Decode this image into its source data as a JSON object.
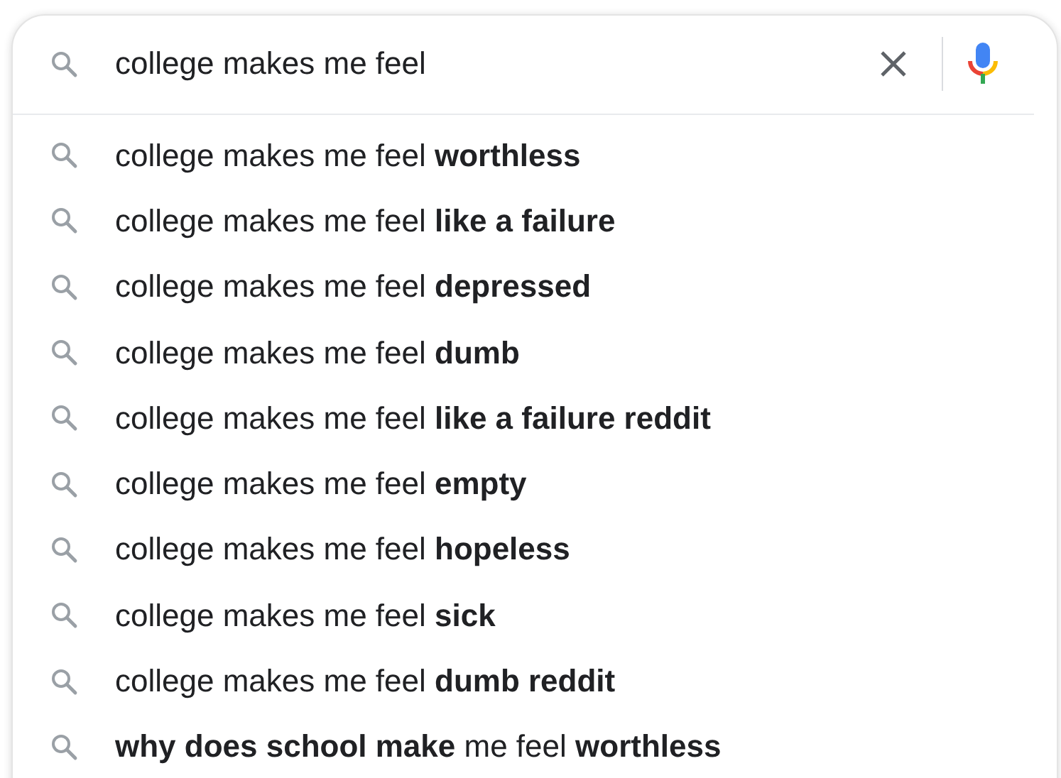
{
  "search": {
    "value": "college makes me feel"
  },
  "suggestions": [
    "college makes me feel **worthless**",
    "college makes me feel **like a failure**",
    "college makes me feel **depressed**",
    "college makes me feel **dumb**",
    "college makes me feel **like a failure reddit**",
    "college makes me feel **empty**",
    "college makes me feel **hopeless**",
    "college makes me feel **sick**",
    "college makes me feel **dumb reddit**",
    "**why does school make** me feel **worthless**"
  ]
}
